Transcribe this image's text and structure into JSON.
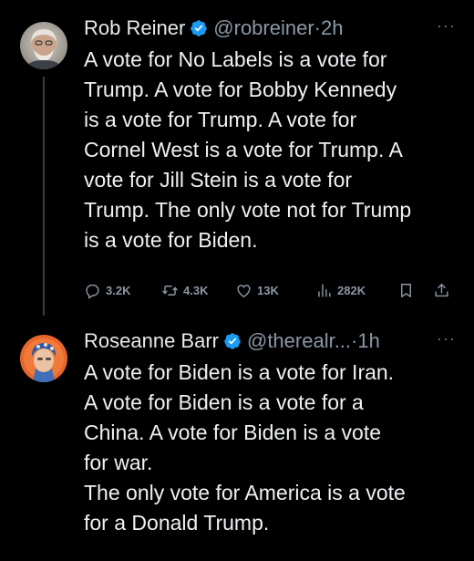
{
  "tweets": [
    {
      "author": {
        "display_name": "Rob Reiner",
        "handle": "@robreiner",
        "time": "2h",
        "avatar_icon": "avatar-gray-haired-man",
        "verified_icon": "verified-badge-icon"
      },
      "text": "A vote for No Labels is a vote for\nTrump. A vote for Bobby Kennedy\nis a vote for Trump. A vote for\nCornel West is a vote for Trump. A\nvote for Jill Stein is a vote for\nTrump. The only vote not for Trump\nis a vote for Biden.",
      "metrics": {
        "replies": "3.2K",
        "retweets": "4.3K",
        "likes": "13K",
        "views": "282K"
      }
    },
    {
      "author": {
        "display_name": "Roseanne Barr",
        "handle": "@therealr...",
        "time": "1h",
        "avatar_icon": "avatar-woman-headscarf",
        "verified_icon": "verified-badge-icon"
      },
      "text": "A vote for Biden is a vote for Iran.\nA vote for Biden is a vote for a\nChina. A vote for Biden is a vote\nfor war.\nThe only vote for America is a vote\nfor a Donald Trump."
    }
  ],
  "separator": "·",
  "more_label": "···",
  "colors": {
    "background": "#000000",
    "text": "#e7e9ea",
    "secondary": "#8b98a5",
    "verified": "#1d9bf0",
    "thread_line": "#3a3d41"
  }
}
